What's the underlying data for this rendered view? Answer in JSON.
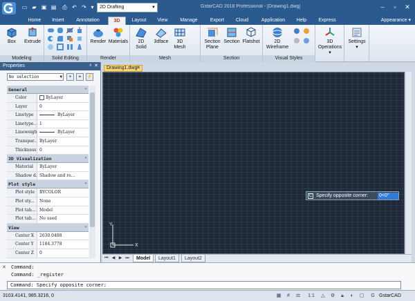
{
  "titlebar": {
    "workspace": "2D Drafting",
    "title": "GstarCAD 2018 Professional - [Drawing1.dwg]"
  },
  "ribbon": {
    "tabs": [
      "Home",
      "Insert",
      "Annotation",
      "3D",
      "Layout",
      "View",
      "Manage",
      "Export",
      "Cloud",
      "Application",
      "Help",
      "Express"
    ],
    "active_tab": "3D",
    "appearance": "Appearance",
    "groups": {
      "modeling": {
        "label": "Modeling",
        "box": "Box",
        "extrude": "Extrude"
      },
      "solid_editing": {
        "label": "Solid Editing"
      },
      "render": {
        "label": "Render",
        "render": "Render",
        "materials": "Materials"
      },
      "mesh": {
        "label": "Mesh",
        "solid2d": [
          "2D",
          "Solid"
        ],
        "face3d": "3dface",
        "mesh3d": [
          "3D",
          "Mesh"
        ]
      },
      "section": {
        "label": "Section",
        "section_plane": [
          "Section",
          "Plane"
        ],
        "section": "Section",
        "flatshot": "Flatshot"
      },
      "visual_styles": {
        "label": "Visual Styles",
        "wireframe": [
          "2D",
          "Wireframe"
        ]
      },
      "operations": {
        "label": [
          "3D",
          "Operations"
        ]
      },
      "settings": {
        "label": "Settings"
      }
    }
  },
  "properties": {
    "title": "Properties",
    "selection": "No selection",
    "sections": [
      {
        "name": "General",
        "rows": [
          {
            "k": "Color",
            "v": "ByLayer"
          },
          {
            "k": "Layer",
            "v": "0"
          },
          {
            "k": "Linetype",
            "v": "ByLayer"
          },
          {
            "k": "Linetype...",
            "v": "1"
          },
          {
            "k": "Lineweight",
            "v": "ByLayer"
          },
          {
            "k": "Transpar...",
            "v": "ByLayer"
          },
          {
            "k": "Thickness",
            "v": "0"
          }
        ]
      },
      {
        "name": "3D Visualization",
        "rows": [
          {
            "k": "Material",
            "v": "ByLayer"
          },
          {
            "k": "Shadow d...",
            "v": "Shadow and re..."
          }
        ]
      },
      {
        "name": "Plot style",
        "rows": [
          {
            "k": "Plot style",
            "v": "BYCOLOR"
          },
          {
            "k": "Plot sty...",
            "v": "None"
          },
          {
            "k": "Plot tab...",
            "v": "Model"
          },
          {
            "k": "Plot tab...",
            "v": "No used"
          }
        ]
      },
      {
        "name": "View",
        "rows": [
          {
            "k": "Center X",
            "v": "2630.0488"
          },
          {
            "k": "Center Y",
            "v": "1184.3778"
          },
          {
            "k": "Center Z",
            "v": "0"
          }
        ]
      }
    ]
  },
  "document": {
    "tab": "Drawing1.dwg"
  },
  "canvas": {
    "prompt": "Specify opposite corner:",
    "value": "0<0°",
    "ucs_x": "X",
    "ucs_y": "Y"
  },
  "layouts": [
    "Model",
    "Layout1",
    "Layout2"
  ],
  "command": {
    "lines": [
      "Command:",
      "Command: _register",
      "Command: Specify opposite corner:"
    ]
  },
  "status": {
    "coords": "3103.4141, 985.3216, 0",
    "scale": "1:1",
    "brand": "GstarCAD"
  },
  "colors": {
    "titlebar": "#2b5a8f",
    "canvas": "#1f2937",
    "doc_tab": "#f6d67a",
    "accent": "#2f7bd8"
  }
}
